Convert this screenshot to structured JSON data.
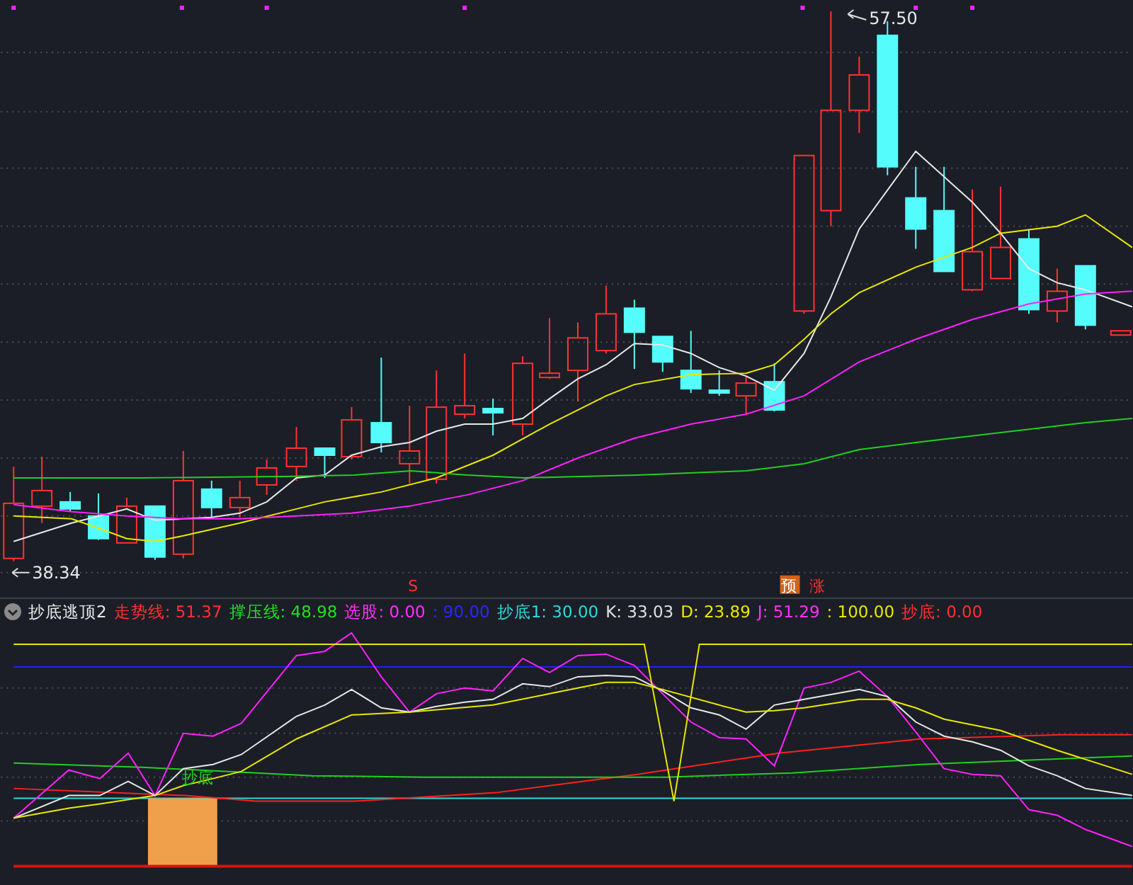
{
  "price_chart": {
    "high_label": "57.50",
    "low_label": "38.34",
    "signals": [
      {
        "kind": "marker",
        "text": "S"
      },
      {
        "kind": "tag",
        "text": "预"
      },
      {
        "kind": "plain",
        "text": "涨"
      }
    ]
  },
  "indicator": {
    "name": "抄底逃顶2",
    "legend": [
      {
        "label": "走势线:",
        "value": "51.37",
        "color": "#ff3030"
      },
      {
        "label": "撑压线:",
        "value": "48.98",
        "color": "#20e020"
      },
      {
        "label": "选股:",
        "value": "0.00",
        "color": "#ff30ff"
      },
      {
        "label": ":",
        "value": "90.00",
        "color": "#2828ff"
      },
      {
        "label": "抄底1:",
        "value": "30.00",
        "color": "#30d8d8"
      },
      {
        "label": "K:",
        "value": "33.03",
        "color": "#e0e0e0"
      },
      {
        "label": "D:",
        "value": "23.89",
        "color": "#e8e800"
      },
      {
        "label": "J:",
        "value": "51.29",
        "color": "#ff30ff"
      },
      {
        "label": ":",
        "value": "100.00",
        "color": "#e8e800"
      },
      {
        "label": "抄底:",
        "value": "0.00",
        "color": "#ff3030"
      }
    ],
    "bottom_label": "抄底"
  }
}
